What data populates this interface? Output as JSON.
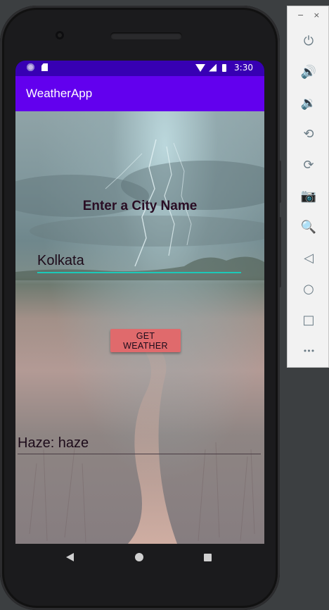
{
  "emulator_window": {
    "minimize": "−",
    "close": "×",
    "tools": [
      {
        "name": "power-icon",
        "glyph": "⏻"
      },
      {
        "name": "volume-up-icon",
        "glyph": "🔊"
      },
      {
        "name": "volume-down-icon",
        "glyph": "🔉"
      },
      {
        "name": "rotate-left-icon",
        "glyph": "⟲"
      },
      {
        "name": "rotate-right-icon",
        "glyph": "⟳"
      },
      {
        "name": "camera-icon",
        "glyph": "📷"
      },
      {
        "name": "zoom-icon",
        "glyph": "🔍"
      },
      {
        "name": "back-icon",
        "glyph": "◁"
      },
      {
        "name": "home-icon",
        "glyph": "○"
      },
      {
        "name": "overview-icon",
        "glyph": "□"
      },
      {
        "name": "more-icon",
        "glyph": "•••"
      }
    ]
  },
  "status_bar": {
    "time": "3:30",
    "left_icons": [
      "circle-notification-icon",
      "sd-card-icon"
    ],
    "right_icons": [
      "wifi-icon",
      "signal-icon",
      "battery-icon"
    ],
    "color": "#3700b3"
  },
  "app_bar": {
    "title": "WeatherApp",
    "color": "#6200ee"
  },
  "main": {
    "heading": "Enter a City Name",
    "city_input_value": "Kolkata",
    "get_weather_button": "GET WEATHER",
    "result_text": "Haze: haze",
    "accent_color": "#1cc9b8",
    "button_color": "#e06a6c"
  },
  "nav_bar": {
    "icons": [
      "nav-back-icon",
      "nav-home-icon",
      "nav-recent-icon"
    ]
  }
}
